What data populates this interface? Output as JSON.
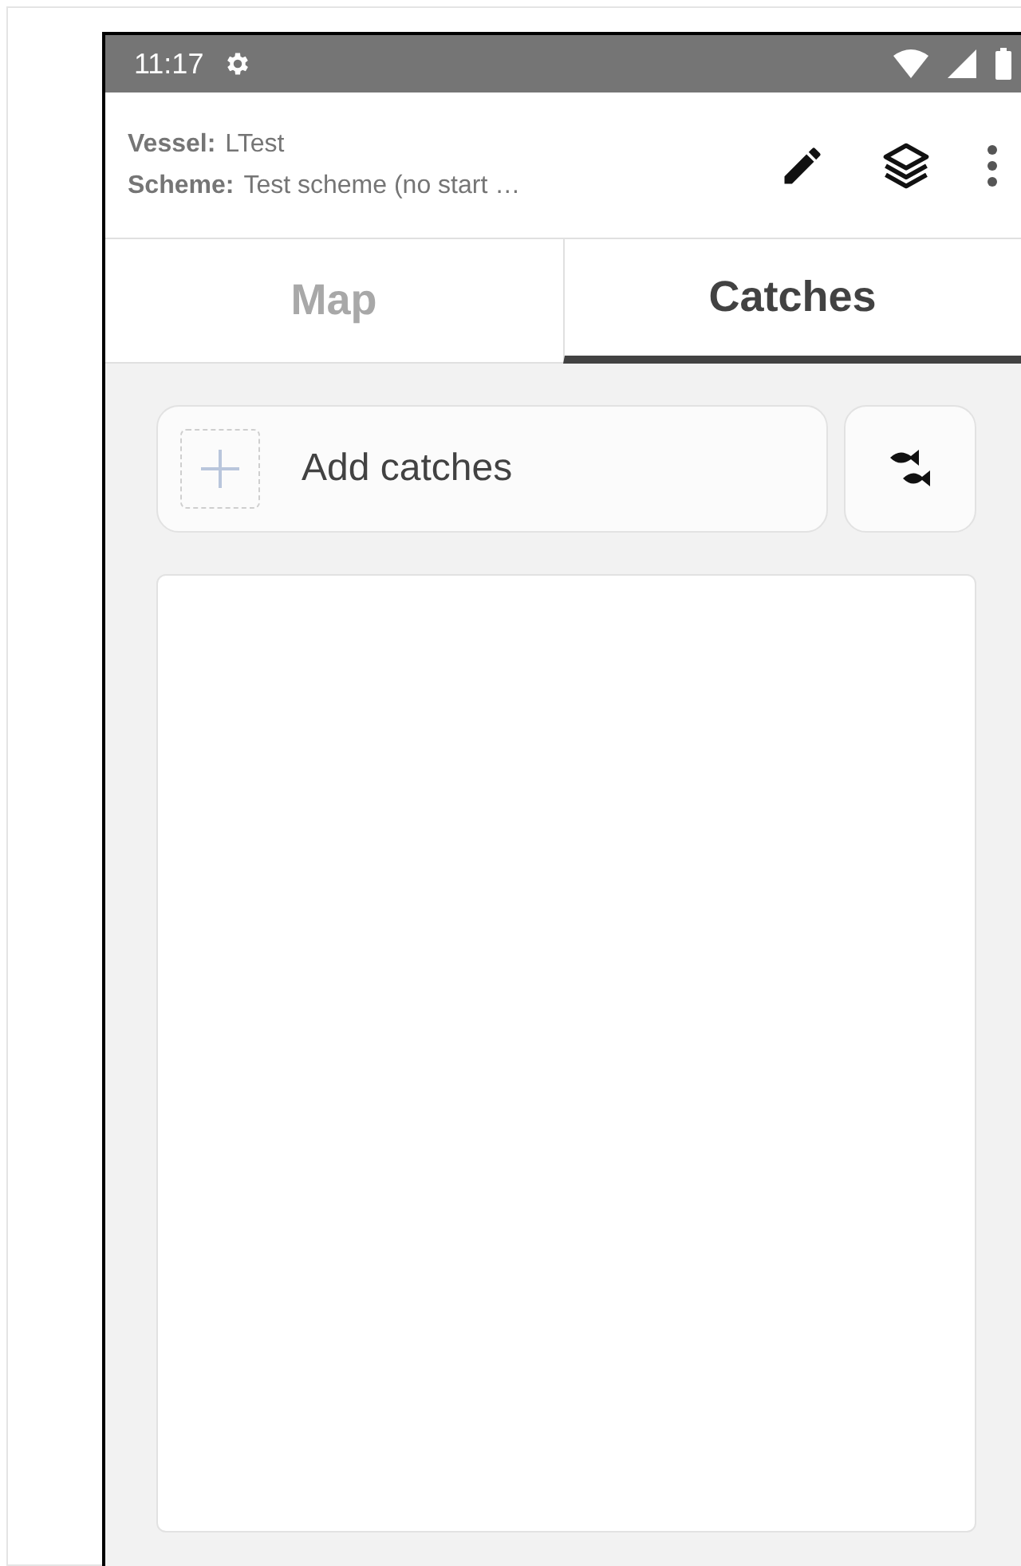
{
  "status_bar": {
    "time": "11:17"
  },
  "header": {
    "fields": [
      {
        "label": "Vessel:",
        "value": "LTest"
      },
      {
        "label": "Scheme:",
        "value": "Test scheme (no start …"
      }
    ]
  },
  "tabs": [
    {
      "label": "Map",
      "selected": false
    },
    {
      "label": "Catches",
      "selected": true
    }
  ],
  "add_button": {
    "label": "Add catches"
  }
}
